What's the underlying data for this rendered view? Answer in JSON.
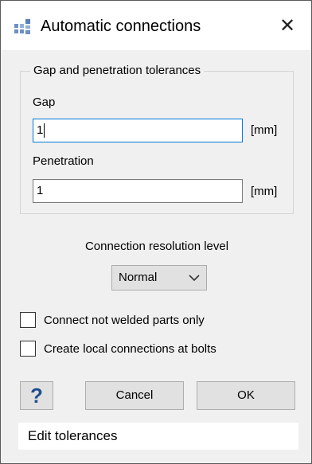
{
  "window": {
    "title": "Automatic connections",
    "close_glyph": "✕",
    "icon": "connections-app-icon"
  },
  "tolerances": {
    "group_title": "Gap and penetration tolerances",
    "gap": {
      "label": "Gap",
      "value": "1",
      "unit": "[mm]"
    },
    "penetration": {
      "label": "Penetration",
      "value": "1",
      "unit": "[mm]"
    }
  },
  "resolution": {
    "label": "Connection resolution level",
    "selected": "Normal"
  },
  "options": [
    {
      "label": "Connect not welded parts only",
      "checked": false
    },
    {
      "label": "Create local connections at bolts",
      "checked": false
    }
  ],
  "buttons": {
    "help": "?",
    "cancel": "Cancel",
    "ok": "OK"
  },
  "status": {
    "text": "Edit tolerances"
  }
}
